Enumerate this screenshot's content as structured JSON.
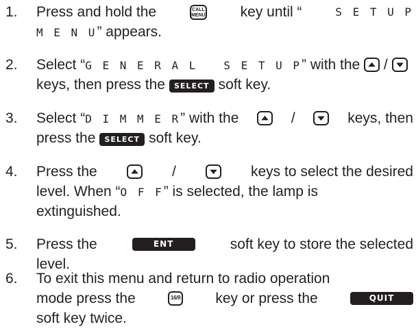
{
  "steps": [
    {
      "num": "1.",
      "l1_a": "Press and hold the",
      "l1_b": "key until “",
      "l1_c": "S E T U P",
      "l2_a": "M E N U",
      "l2_b": "” appears."
    },
    {
      "num": "2.",
      "l1_a": "Select “",
      "l1_b": "G E N E R A L   S E T U P",
      "l1_c": "” with the",
      "l1_d": "/",
      "l2_a": "keys, then press the",
      "l2_b": "soft key."
    },
    {
      "num": "3.",
      "l1_a": "Select “",
      "l1_b": "D I M M E R",
      "l1_c": "” with the",
      "l1_d": "/",
      "l1_e": "keys, then",
      "l2_a": "press the",
      "l2_b": "soft key."
    },
    {
      "num": "4.",
      "l1_a": "Press the",
      "l1_b": "/",
      "l1_c": "keys to select the desired",
      "l2_a": "level. When “",
      "l2_b": "O F F",
      "l2_c": "” is selected, the lamp is",
      "l3": "extinguished."
    },
    {
      "num": "5.",
      "l1_a": "Press the",
      "l1_b": "soft key to store the selected",
      "l2": "level."
    },
    {
      "num": "6.",
      "l1": "To exit this menu and return to radio operation",
      "l2_a": "mode press the",
      "l2_b": "key or press the",
      "l3": "soft key twice."
    }
  ],
  "keys": {
    "call_line1": "CALL",
    "call_line2": "MENU",
    "key_169": "16/9",
    "up_icon": "up-arrow-key-icon",
    "down_icon": "down-arrow-key-icon",
    "soft_select": "SELECT",
    "soft_ent": "ENT",
    "soft_quit": "QUIT"
  }
}
